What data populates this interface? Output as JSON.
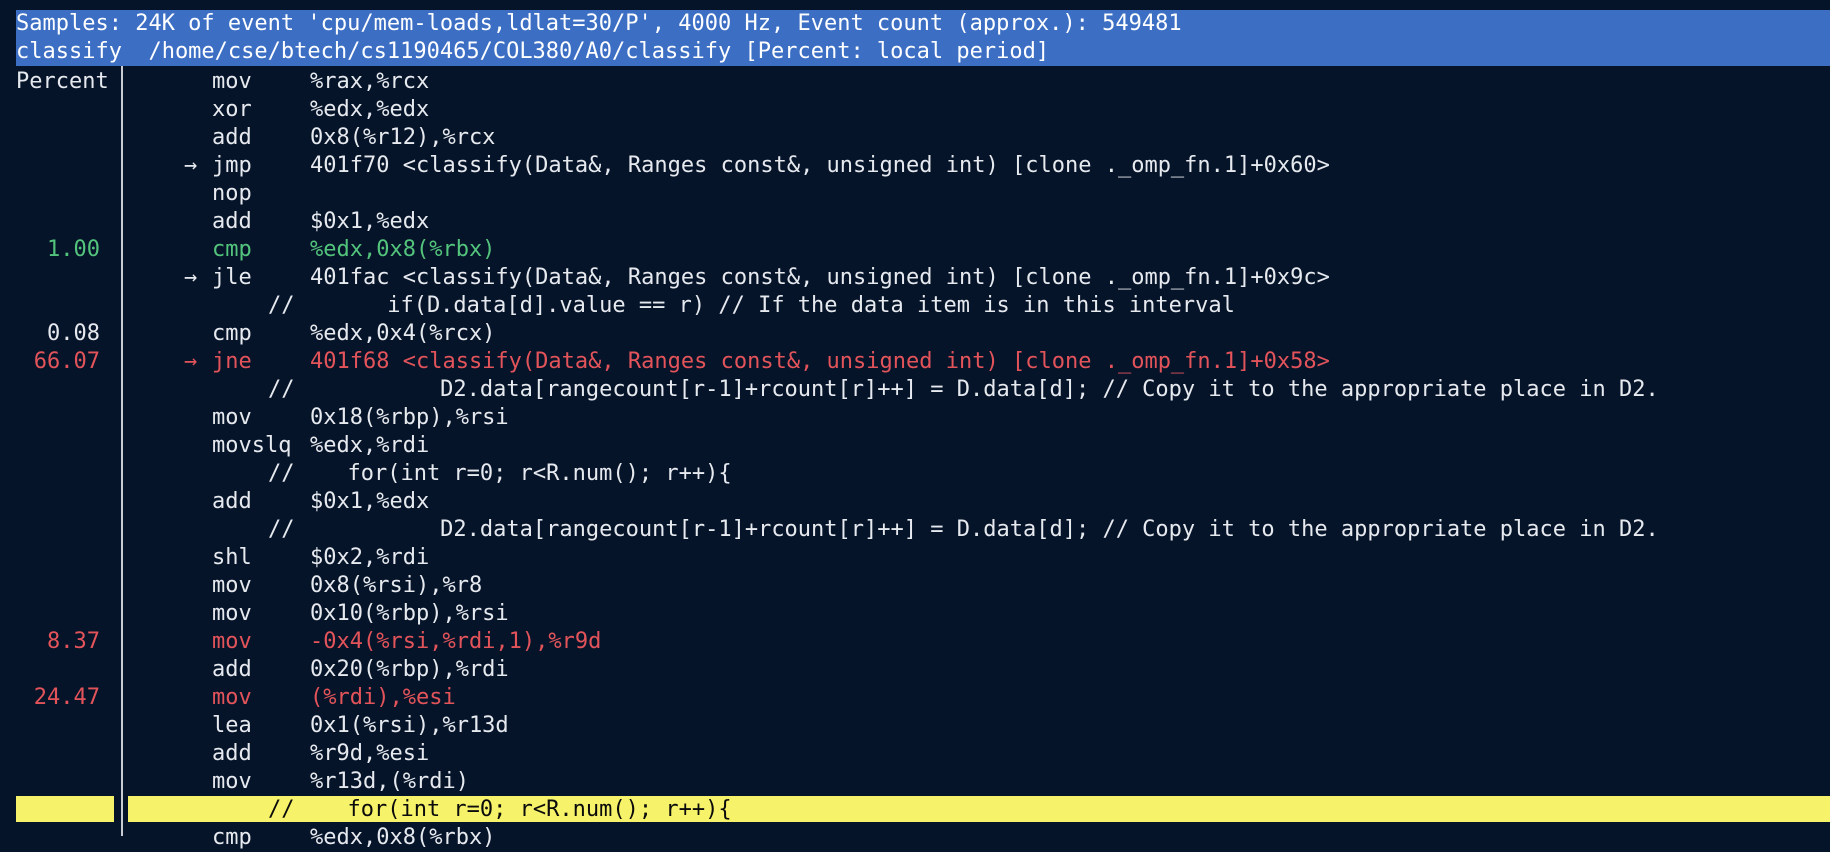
{
  "header": {
    "line1": "Samples: 24K of event 'cpu/mem-loads,ldlat=30/P', 4000 Hz, Event count (approx.): 549481",
    "line2": "classify  /home/cse/btech/cs1190465/COL380/A0/classify [Percent: local period]"
  },
  "column_label": "Percent",
  "lines": [
    {
      "pct": "",
      "arrow": "",
      "mnemonic": "mov",
      "operands": "%rax,%rcx",
      "source": ""
    },
    {
      "pct": "",
      "arrow": "",
      "mnemonic": "xor",
      "operands": "%edx,%edx",
      "source": ""
    },
    {
      "pct": "",
      "arrow": "",
      "mnemonic": "add",
      "operands": "0x8(%r12),%rcx",
      "source": ""
    },
    {
      "pct": "",
      "arrow": "→",
      "mnemonic": "jmp",
      "operands": "401f70 <classify(Data&, Ranges const&, unsigned int) [clone ._omp_fn.1]+0x60>",
      "source": ""
    },
    {
      "pct": "",
      "arrow": "",
      "mnemonic": "nop",
      "operands": "",
      "source": ""
    },
    {
      "pct": "",
      "arrow": "",
      "mnemonic": "add",
      "operands": "$0x1,%edx",
      "source": ""
    },
    {
      "pct": "1.00",
      "arrow": "",
      "mnemonic": "cmp",
      "operands": "%edx,0x8(%rbx)",
      "source": "",
      "color": "green"
    },
    {
      "pct": "",
      "arrow": "→",
      "mnemonic": "jle",
      "operands": "401fac <classify(Data&, Ranges const&, unsigned int) [clone ._omp_fn.1]+0x9c>",
      "source": ""
    },
    {
      "pct": "",
      "arrow": "",
      "mnemonic": "",
      "operands": "",
      "source": "//       if(D.data[d].value == r) // If the data item is in this interval"
    },
    {
      "pct": "0.08",
      "arrow": "",
      "mnemonic": "cmp",
      "operands": "%edx,0x4(%rcx)",
      "source": ""
    },
    {
      "pct": "66.07",
      "arrow": "→",
      "mnemonic": "jne",
      "operands": "401f68 <classify(Data&, Ranges const&, unsigned int) [clone ._omp_fn.1]+0x58>",
      "source": "",
      "color": "red"
    },
    {
      "pct": "",
      "arrow": "",
      "mnemonic": "",
      "operands": "",
      "source": "//           D2.data[rangecount[r-1]+rcount[r]++] = D.data[d]; // Copy it to the appropriate place in D2."
    },
    {
      "pct": "",
      "arrow": "",
      "mnemonic": "mov",
      "operands": "0x18(%rbp),%rsi",
      "source": ""
    },
    {
      "pct": "",
      "arrow": "",
      "mnemonic": "movslq",
      "operands": "%edx,%rdi",
      "source": ""
    },
    {
      "pct": "",
      "arrow": "",
      "mnemonic": "",
      "operands": "",
      "source": "//    for(int r=0; r<R.num(); r++){"
    },
    {
      "pct": "",
      "arrow": "",
      "mnemonic": "add",
      "operands": "$0x1,%edx",
      "source": ""
    },
    {
      "pct": "",
      "arrow": "",
      "mnemonic": "",
      "operands": "",
      "source": "//           D2.data[rangecount[r-1]+rcount[r]++] = D.data[d]; // Copy it to the appropriate place in D2."
    },
    {
      "pct": "",
      "arrow": "",
      "mnemonic": "shl",
      "operands": "$0x2,%rdi",
      "source": ""
    },
    {
      "pct": "",
      "arrow": "",
      "mnemonic": "mov",
      "operands": "0x8(%rsi),%r8",
      "source": ""
    },
    {
      "pct": "",
      "arrow": "",
      "mnemonic": "mov",
      "operands": "0x10(%rbp),%rsi",
      "source": ""
    },
    {
      "pct": "8.37",
      "arrow": "",
      "mnemonic": "mov",
      "operands": "-0x4(%rsi,%rdi,1),%r9d",
      "source": "",
      "color": "red"
    },
    {
      "pct": "",
      "arrow": "",
      "mnemonic": "add",
      "operands": "0x20(%rbp),%rdi",
      "source": ""
    },
    {
      "pct": "24.47",
      "arrow": "",
      "mnemonic": "mov",
      "operands": "(%rdi),%esi",
      "source": "",
      "color": "red"
    },
    {
      "pct": "",
      "arrow": "",
      "mnemonic": "lea",
      "operands": "0x1(%rsi),%r13d",
      "source": ""
    },
    {
      "pct": "",
      "arrow": "",
      "mnemonic": "add",
      "operands": "%r9d,%esi",
      "source": ""
    },
    {
      "pct": "",
      "arrow": "",
      "mnemonic": "mov",
      "operands": "%r13d,(%rdi)",
      "source": ""
    },
    {
      "pct": "",
      "arrow": "",
      "mnemonic": "",
      "operands": "",
      "source": "//    for(int r=0; r<R.num(); r++){",
      "selected": true
    },
    {
      "pct": "",
      "arrow": "",
      "mnemonic": "cmp",
      "operands": "%edx,0x8(%rbx)",
      "source": ""
    }
  ],
  "colors": {
    "background": "#06142a",
    "header": "#3c6fc4",
    "text": "#e6e9ee",
    "green": "#53c47c",
    "red": "#e2545a",
    "selection": "#f6f36a"
  }
}
